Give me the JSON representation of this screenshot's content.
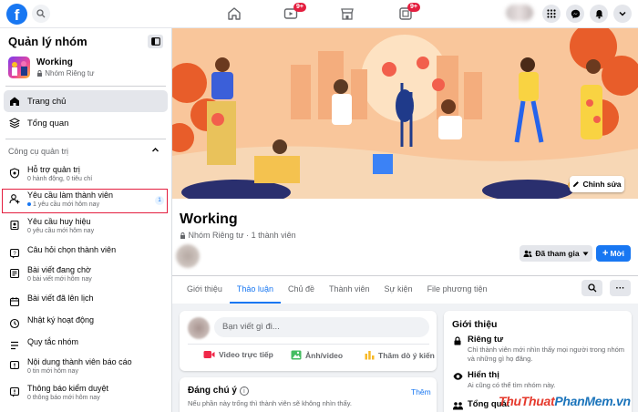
{
  "topbar": {
    "logo": "f",
    "nav_icons": [
      "home-icon",
      "watch-icon",
      "marketplace-icon",
      "groups-icon"
    ],
    "badges": {
      "watch": "9+",
      "groups": "9+"
    },
    "right_icons": [
      "menu-grid-icon",
      "messenger-icon",
      "notifications-icon",
      "account-chevron-icon"
    ]
  },
  "sidebar": {
    "title": "Quản lý nhóm",
    "group": {
      "name": "Working",
      "privacy": "Nhóm Riêng tư"
    },
    "nav": [
      {
        "label": "Trang chủ",
        "icon": "home-icon"
      },
      {
        "label": "Tổng quan",
        "icon": "overview-icon"
      }
    ],
    "section_title": "Công cụ quản trị",
    "tools": [
      {
        "label": "Hỗ trợ quản trị",
        "sub": "0 hành động, 0 tiêu chí"
      },
      {
        "label": "Yêu cầu làm thành viên",
        "sub": "1 yêu cầu mới hôm nay",
        "count": "1"
      },
      {
        "label": "Yêu cầu huy hiệu",
        "sub": "0 yêu cầu mới hôm nay"
      },
      {
        "label": "Câu hỏi chọn thành viên",
        "sub": ""
      },
      {
        "label": "Bài viết đang chờ",
        "sub": "0 bài viết mới hôm nay"
      },
      {
        "label": "Bài viết đã lên lịch",
        "sub": ""
      },
      {
        "label": "Nhật ký hoạt động",
        "sub": ""
      },
      {
        "label": "Quy tắc nhóm",
        "sub": ""
      },
      {
        "label": "Nội dung thành viên báo cáo",
        "sub": "0 tin mới hôm nay"
      },
      {
        "label": "Thông báo kiểm duyệt",
        "sub": "0 thông báo mới hôm nay"
      }
    ]
  },
  "header": {
    "edit_cover": "Chỉnh sửa",
    "group_name": "Working",
    "subtitle": "Nhóm Riêng tư · 1 thành viên",
    "joined": "Đã tham gia",
    "invite": "Mời",
    "tabs": [
      "Giới thiệu",
      "Thảo luận",
      "Chủ đề",
      "Thành viên",
      "Sự kiện",
      "File phương tiện"
    ],
    "active_tab": "Thảo luận",
    "more": "···"
  },
  "composer": {
    "placeholder": "Bạn viết gì đi...",
    "actions": [
      {
        "label": "Video trực tiếp",
        "color": "#f02849"
      },
      {
        "label": "Ảnh/video",
        "color": "#45bd62"
      },
      {
        "label": "Thăm dò ý kiến",
        "color": "#f7b928"
      }
    ]
  },
  "pending": {
    "title": "Đáng chú ý",
    "info": "i",
    "see_more": "Thêm",
    "text": "Nếu phần này trống thì thành viên sẽ không nhìn thấy."
  },
  "about": {
    "title": "Giới thiệu",
    "rows": [
      {
        "heading": "Riêng tư",
        "desc": "Chỉ thành viên mới nhìn thấy mọi người trong nhóm và những gì họ đăng."
      },
      {
        "heading": "Hiển thị",
        "desc": "Ai cũng có thể tìm nhóm này."
      },
      {
        "heading": "Tổng quát",
        "desc": ""
      }
    ]
  },
  "watermark": {
    "part1": "ThuThuat",
    "part2": "PhanMem",
    "part3": ".vn"
  }
}
